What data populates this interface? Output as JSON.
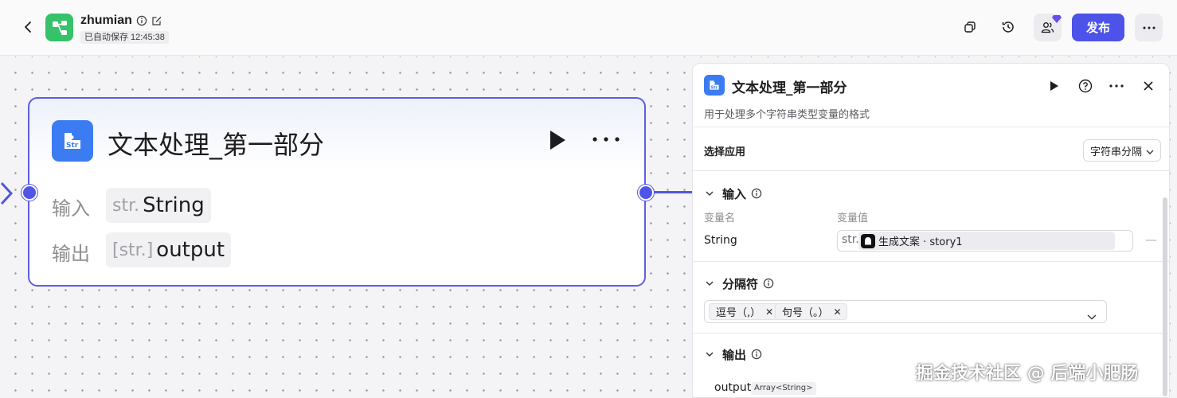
{
  "header": {
    "app_name": "zhumian",
    "save_status": "已自动保存 12:45:38",
    "publish_label": "发布",
    "icons": [
      "back-arrow-icon",
      "app-icon",
      "info-icon",
      "edit-icon",
      "copy-icon",
      "history-icon",
      "collaborators-icon",
      "more-icon"
    ]
  },
  "node": {
    "title": "文本处理_第一部分",
    "input_label": "输入",
    "input_prefix": "str.",
    "input_value": "String",
    "output_label": "输出",
    "output_prefix": "[str.]",
    "output_value": "output"
  },
  "panel": {
    "title": "文本处理_第一部分",
    "description": "用于处理多个字符串类型变量的格式",
    "select_app_label": "选择应用",
    "select_app_value": "字符串分隔",
    "input_section": "输入",
    "col_var_name": "变量名",
    "col_var_value": "变量值",
    "var_name": "String",
    "var_prefix": "str.",
    "var_ref": "生成文案 · story1",
    "var_clear": "×",
    "delimiter_section": "分隔符",
    "tags": [
      "逗号（,）",
      "句号（。）"
    ],
    "output_section": "输出",
    "output_name": "output",
    "output_type": "Array<String>"
  },
  "watermark": "掘金技术社区 @ 后端小肥肠",
  "colors": {
    "accent": "#4d53e8",
    "node_border": "#5b5fe3",
    "node_icon": "#3b7cf2",
    "app_icon": "#36c26a"
  }
}
